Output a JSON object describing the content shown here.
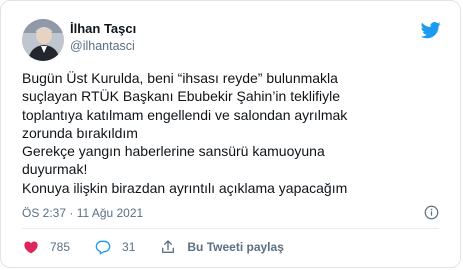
{
  "user": {
    "name": "İlhan Taşcı",
    "handle": "@ilhantasci"
  },
  "tweet": {
    "lines": [
      "Bugün Üst Kurulda, beni “ihsası reyde” bulunmakla",
      "suçlayan RTÜK Başkanı Ebubekir Şahin’in teklifiyle",
      "toplantıya katılmam engellendi ve salondan ayrılmak",
      "zorunda bırakıldım",
      "Gerekçe yangın haberlerine sansürü kamuoyuna",
      "duyurmak!",
      "Konuya ilişkin birazdan ayrıntılı açıklama yapacağım"
    ],
    "timestamp": "ÖS 2:37 · 11 Ağu 2021"
  },
  "actions": {
    "likes": "785",
    "replies": "31",
    "share_label": "Bu Tweeti paylaş"
  },
  "colors": {
    "brand": "#1d9bf0",
    "like_red": "#e0245e",
    "muted": "#5b7083",
    "text": "#0f1419"
  },
  "icons": [
    "twitter-bird-icon",
    "info-icon",
    "heart-icon",
    "reply-icon",
    "share-icon"
  ]
}
